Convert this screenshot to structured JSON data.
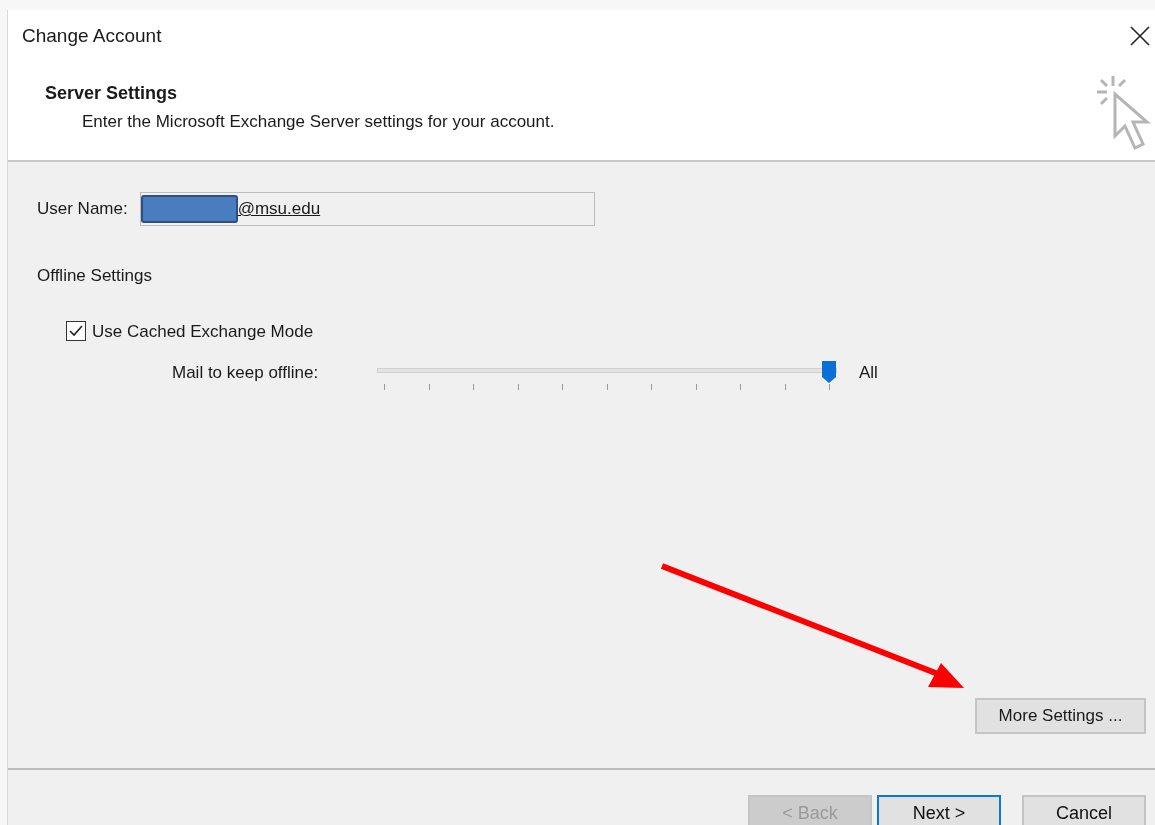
{
  "window": {
    "title": "Change Account"
  },
  "header": {
    "title": "Server Settings",
    "subtitle": "Enter the Microsoft Exchange Server settings for your account."
  },
  "user_name": {
    "label": "User Name:",
    "value": "@msu.edu",
    "redacted": true
  },
  "offline": {
    "heading": "Offline Settings",
    "cached_mode": {
      "label": "Use Cached Exchange Mode",
      "checked": true
    },
    "slider": {
      "label": "Mail to keep offline:",
      "level": 1,
      "reading": "All"
    }
  },
  "more_settings": {
    "label": "More Settings ..."
  },
  "buttons": [
    {
      "label": "< Back",
      "disabled": true,
      "default": false
    },
    {
      "label": "Next >",
      "disabled": false,
      "default": true
    },
    {
      "label": "Cancel",
      "disabled": false,
      "default": false
    }
  ]
}
